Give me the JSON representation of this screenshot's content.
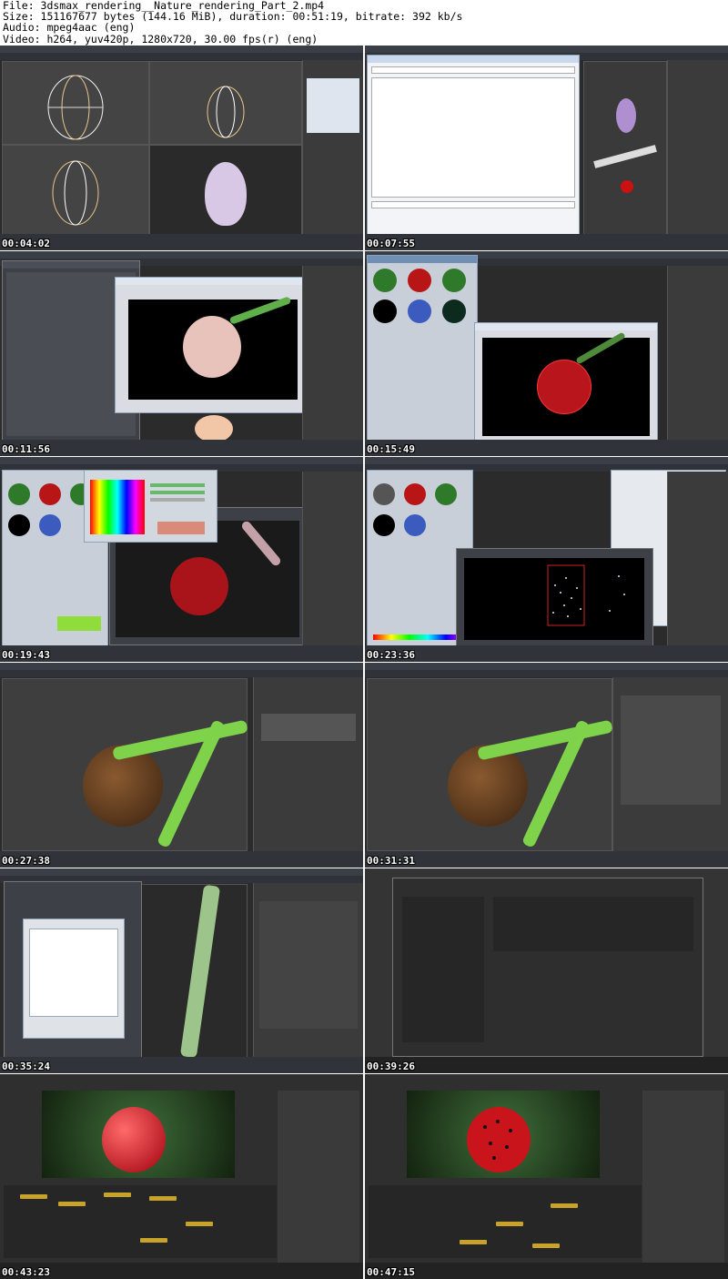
{
  "header": {
    "file_line": "File: 3dsmax_rendering__Nature_rendering_Part_2.mp4",
    "size_line": "Size: 151167677 bytes (144.16 MiB), duration: 00:51:19, bitrate: 392 kb/s",
    "audio_line": "Audio: mpeg4aac (eng)",
    "video_line": "Video: h264, yuv420p, 1280x720, 30.00 fps(r) (eng)"
  },
  "thumbnails": [
    {
      "timestamp": "00:04:02",
      "scene": "3ds Max viewports - egg wireframe modeling"
    },
    {
      "timestamp": "00:07:55",
      "scene": "Save File dialog"
    },
    {
      "timestamp": "00:11:56",
      "scene": "Render Setup V-Ray - pale tomato render"
    },
    {
      "timestamp": "00:15:49",
      "scene": "Material Editor - red tomato frame buffer"
    },
    {
      "timestamp": "00:19:43",
      "scene": "Color Selector - red tomato render"
    },
    {
      "timestamp": "00:23:36",
      "scene": "Frame buffer - particles render"
    },
    {
      "timestamp": "00:27:38",
      "scene": "Shaded viewport - brown tomato with green stem"
    },
    {
      "timestamp": "00:31:31",
      "scene": "Shaded viewport - brown tomato with material panel"
    },
    {
      "timestamp": "00:35:24",
      "scene": "Render Elements dialog"
    },
    {
      "timestamp": "00:39:26",
      "scene": "Fusion - file browser"
    },
    {
      "timestamp": "00:43:23",
      "scene": "Fusion - red tomato composite with node graph"
    },
    {
      "timestamp": "00:47:15",
      "scene": "Fusion - red tomato with black spots composite"
    }
  ],
  "colors": {
    "max_ui": "#3b3b3b",
    "tomato_red": "#b8161c",
    "stem_green": "#7fd34a",
    "fusion_node": "#c9a22a"
  }
}
